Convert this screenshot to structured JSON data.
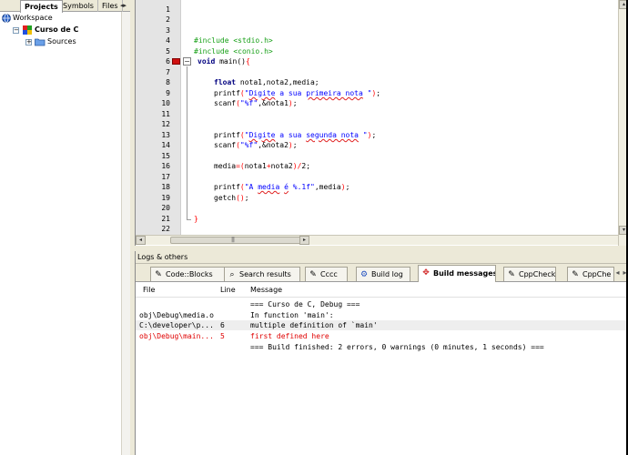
{
  "left_panel": {
    "tabs": [
      "Projects",
      "Symbols",
      "Files"
    ],
    "active_tab": "Projects",
    "tree": {
      "workspace": "Workspace",
      "project": "Curso de C",
      "folder": "Sources"
    }
  },
  "editor": {
    "line_numbers": [
      "1",
      "2",
      "3",
      "4",
      "5",
      "6",
      "7",
      "8",
      "9",
      "10",
      "11",
      "12",
      "13",
      "14",
      "15",
      "16",
      "17",
      "18",
      "19",
      "20",
      "21",
      "22"
    ],
    "error_marker_line": "6",
    "lines": {
      "l4": "#include <stdio.h>",
      "l5": "#include <conio.h>",
      "l6_kw": "void",
      "l6_rest": " main()",
      "l6_brace": "{",
      "l8_kw": "float",
      "l8_rest": " nota1,nota2,media;",
      "l9_fn": "printf",
      "l9_str1": "\"",
      "l9_sq1": "Digite",
      "l9_str2": " a sua ",
      "l9_sq2": "primeira nota",
      "l9_str3": " \"",
      "l10_fn": "scanf",
      "l10_str": "\"%f\"",
      "l10_rest": ",&nota1",
      "l13_fn": "printf",
      "l13_str1": "\"",
      "l13_sq1": "Digite",
      "l13_str2": " a sua ",
      "l13_sq2": "segunda nota",
      "l13_str3": " \"",
      "l14_fn": "scanf",
      "l14_str": "\"%f\"",
      "l14_rest": ",&nota2",
      "l16_a": "media",
      "l16_b": "nota1",
      "l16_c": "nota2",
      "l16_d": "2",
      "l18_fn": "printf",
      "l18_str1": "\"A ",
      "l18_sq1": "media",
      "l18_str2": " ",
      "l18_sq2": "é",
      "l18_str3": " %.1f\"",
      "l18_rest": ",media",
      "l19_fn": "getch",
      "l21_brace": "}"
    }
  },
  "logs": {
    "title": "Logs & others",
    "tabs": [
      {
        "label": "Code::Blocks",
        "icon": "pencil-icon"
      },
      {
        "label": "Search results",
        "icon": "search-icon"
      },
      {
        "label": "Cccc",
        "icon": "pencil-icon"
      },
      {
        "label": "Build log",
        "icon": "gear-icon"
      },
      {
        "label": "Build messages",
        "icon": "pin-icon"
      },
      {
        "label": "CppCheck",
        "icon": "pencil-icon"
      },
      {
        "label": "CppChe",
        "icon": "pencil-icon"
      }
    ],
    "active_tab": "Build messages",
    "columns": {
      "file": "File",
      "line": "Line",
      "message": "Message"
    },
    "rows": [
      {
        "file": "",
        "line": "",
        "message": "=== Curso de C, Debug ===",
        "error": false
      },
      {
        "file": "obj\\Debug\\media.o",
        "line": "",
        "message": "In function 'main':",
        "error": false
      },
      {
        "file": "C:\\developer\\p...",
        "line": "6",
        "message": "multiple definition of `main'",
        "error": false
      },
      {
        "file": "obj\\Debug\\main...",
        "line": "5",
        "message": "first defined here",
        "error": true
      },
      {
        "file": "",
        "line": "",
        "message": "=== Build finished: 2 errors, 0 warnings (0 minutes, 1 seconds) ===",
        "error": false
      }
    ]
  },
  "colors": {
    "preprocessor": "#17a017",
    "keyword": "#000080",
    "string": "#0000ff",
    "operator": "#ff0000",
    "error_text": "#e00000",
    "error_marker": "#d01010"
  }
}
